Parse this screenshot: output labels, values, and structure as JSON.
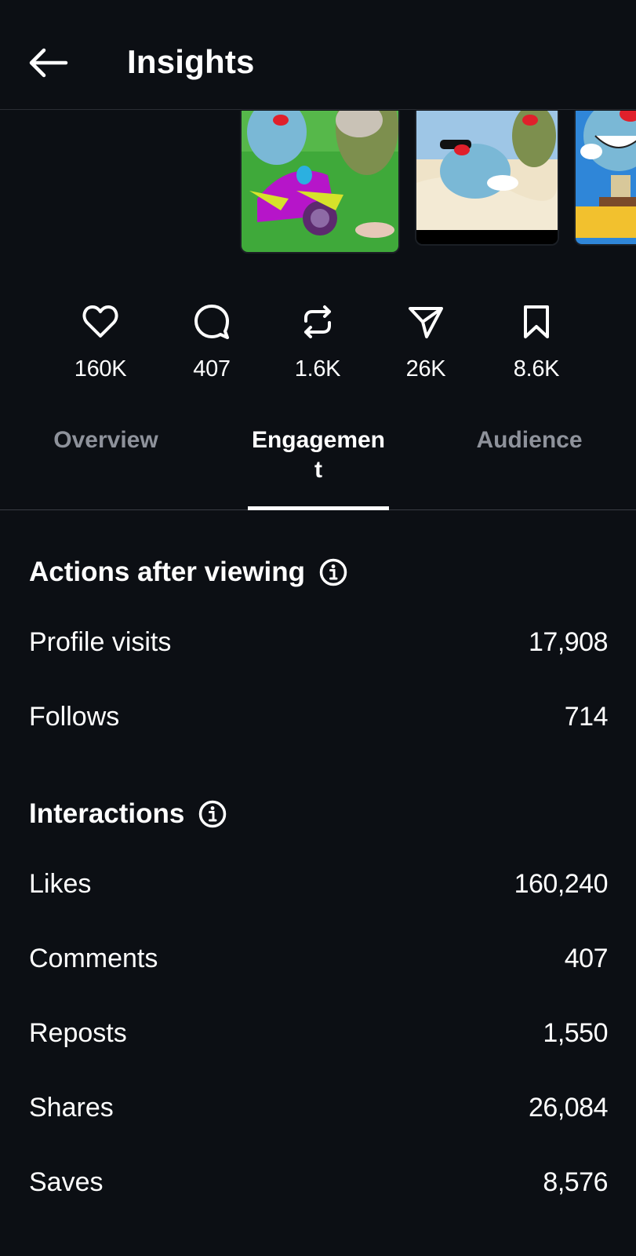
{
  "header": {
    "title": "Insights"
  },
  "thumbnails": [
    {
      "icon": "video-thumbnail-scooter"
    },
    {
      "icon": "video-thumbnail-beach"
    },
    {
      "icon": "video-thumbnail-table"
    }
  ],
  "stats": {
    "likes": "160K",
    "comments": "407",
    "reposts": "1.6K",
    "shares": "26K",
    "saves": "8.6K"
  },
  "tabs": {
    "overview": "Overview",
    "engagement": "Engagement",
    "audience": "Audience",
    "selected": "engagement"
  },
  "actions_after_viewing": {
    "title": "Actions after viewing",
    "rows": [
      {
        "label": "Profile visits",
        "value": "17,908"
      },
      {
        "label": "Follows",
        "value": "714"
      }
    ]
  },
  "interactions": {
    "title": "Interactions",
    "rows": [
      {
        "label": "Likes",
        "value": "160,240"
      },
      {
        "label": "Comments",
        "value": "407"
      },
      {
        "label": "Reposts",
        "value": "1,550"
      },
      {
        "label": "Shares",
        "value": "26,084"
      },
      {
        "label": "Saves",
        "value": "8,576"
      }
    ]
  },
  "colors": {
    "background": "#0c0f14",
    "text": "#ffffff",
    "muted": "#8e929b",
    "divider": "#2a2d33"
  }
}
